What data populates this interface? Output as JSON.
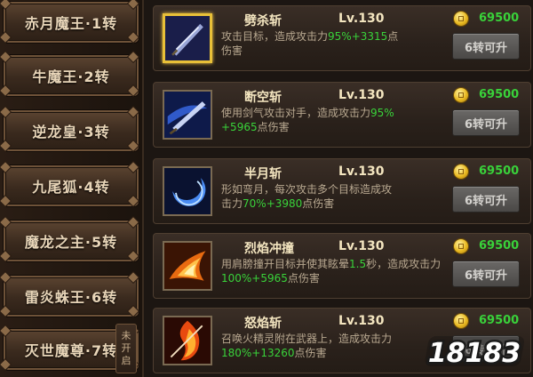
{
  "tiers": [
    {
      "label": "赤月魔王·1转"
    },
    {
      "label": "牛魔王·2转"
    },
    {
      "label": "逆龙皇·3转"
    },
    {
      "label": "九尾狐·4转"
    },
    {
      "label": "魔龙之主·5转"
    },
    {
      "label": "雷炎蛛王·6转"
    },
    {
      "label": "灭世魔尊·7转"
    }
  ],
  "locked_badge": {
    "line1": "未",
    "line2": "开",
    "line3": "启"
  },
  "skills": [
    {
      "name": "劈杀斩",
      "level": "Lv.130",
      "cost": "69500",
      "button": "6转可升",
      "desc_a": "攻击目标，造成攻击力",
      "desc_b": "95%+3315",
      "desc_c": "点",
      "desc_d": "伤害",
      "icon": "sword-slash-icon",
      "selected": true
    },
    {
      "name": "断空斩",
      "level": "Lv.130",
      "cost": "69500",
      "button": "6转可升",
      "desc_a": "使用剑气攻击对手，造成攻击力",
      "desc_b": "95%",
      "desc_c": "+5965",
      "desc_d": "点伤害",
      "icon": "sword-energy-icon",
      "selected": false
    },
    {
      "name": "半月斩",
      "level": "Lv.130",
      "cost": "69500",
      "button": "6转可升",
      "desc_a": "形如弯月，每次攻击多个目标造成攻",
      "desc_b": "击力",
      "desc_c": "70%+3980",
      "desc_d": "点伤害",
      "icon": "crescent-moon-icon",
      "selected": false
    },
    {
      "name": "烈焰冲撞",
      "level": "Lv.130",
      "cost": "69500",
      "button": "6转可升",
      "desc_a": "用肩膀撞开目标并使其眩晕",
      "desc_b": "1.5",
      "desc_c": "秒，造成攻击力",
      "desc_d": "100%+5965",
      "desc_e": "点伤害",
      "icon": "flame-charge-icon",
      "selected": false
    },
    {
      "name": "怒焰斩",
      "level": "Lv.130",
      "cost": "69500",
      "button": "6转可升",
      "desc_a": "召唤火精灵附在武器上，造成攻击力",
      "desc_b": "180%+13260",
      "desc_c": "点伤害",
      "icon": "fire-blade-icon",
      "selected": false
    }
  ],
  "watermark": {
    "text": "18183"
  },
  "colors": {
    "green": "#39d23a",
    "gold_border": "#e8c038",
    "label": "#e8d5b8"
  }
}
